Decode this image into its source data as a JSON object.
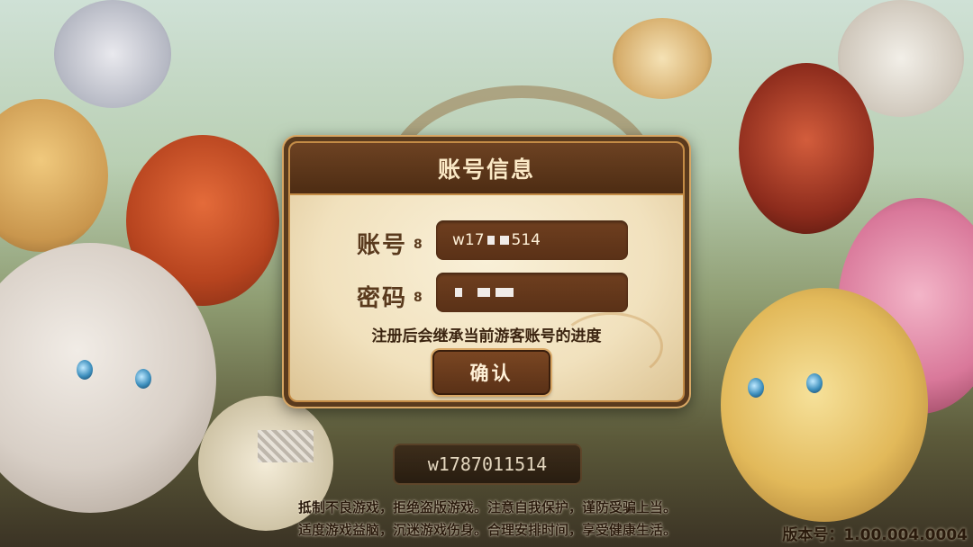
{
  "dialog": {
    "title": "账号信息",
    "account_label": "账号",
    "account_value": "w17",
    "account_value_tail": "514",
    "password_label": "密码",
    "colon": "8",
    "note": "注册后会继承当前游客账号的进度",
    "confirm_label": "确认"
  },
  "footer": {
    "account_id": "w1787011514",
    "notice_line1": "抵制不良游戏，拒绝盗版游戏。注意自我保护，谨防受骗上当。",
    "notice_line2": "适度游戏益脑，沉迷游戏伤身。合理安排时间，享受健康生活。",
    "version": "版本号：1.00.004.0004"
  },
  "colors": {
    "dialog_frame": "#5a3a1d",
    "dialog_bg": "#f1e1bd",
    "accent_gold": "#d8a765",
    "text_brown": "#3b2410"
  }
}
